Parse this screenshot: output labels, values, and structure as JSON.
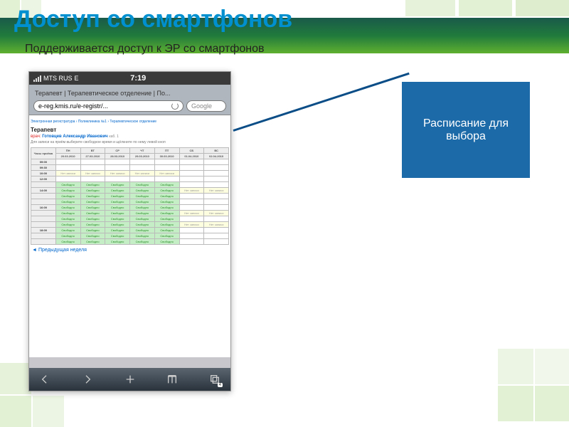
{
  "slide": {
    "title": "Доступ со смартфонов",
    "subtitle": "Поддерживается доступ к ЭР со смартфонов"
  },
  "callout": {
    "text": "Расписание для выбора"
  },
  "phone": {
    "carrier": "MTS RUS",
    "network": "E",
    "time": "7:19",
    "page_title": "Терапевт | Терапевтическое отделение | По...",
    "url": "e-reg.kmis.ru/e-registr/...",
    "search_placeholder": "Google",
    "breadcrumb": "Электронная регистратура › Поликлиника №1 › Терапевтическое отделение",
    "department": "Терапевт",
    "doctor_label": "врач:",
    "doctor_name": "Готовцев Александр Иванович",
    "cabinet": "каб. 1",
    "instruction": "Для записи на приём выберите свободное время и щёлкните по нему левой кноп",
    "schedule_time_header": "Часы приёма",
    "days": [
      {
        "dow": "ПН",
        "date": "20.03.2010"
      },
      {
        "dow": "ВТ",
        "date": "27.03.2010"
      },
      {
        "dow": "СР",
        "date": "28.03.2010"
      },
      {
        "dow": "ЧТ",
        "date": "29.03.2010"
      },
      {
        "dow": "ПТ",
        "date": "30.03.2010"
      },
      {
        "dow": "СБ",
        "date": "01.04.2010"
      },
      {
        "dow": "ВС",
        "date": "02.04.2010"
      }
    ],
    "status_free": "Свободно",
    "status_busy": "Нет записи",
    "prev_week": "Предыдущая неделя",
    "pages_count": "4"
  }
}
